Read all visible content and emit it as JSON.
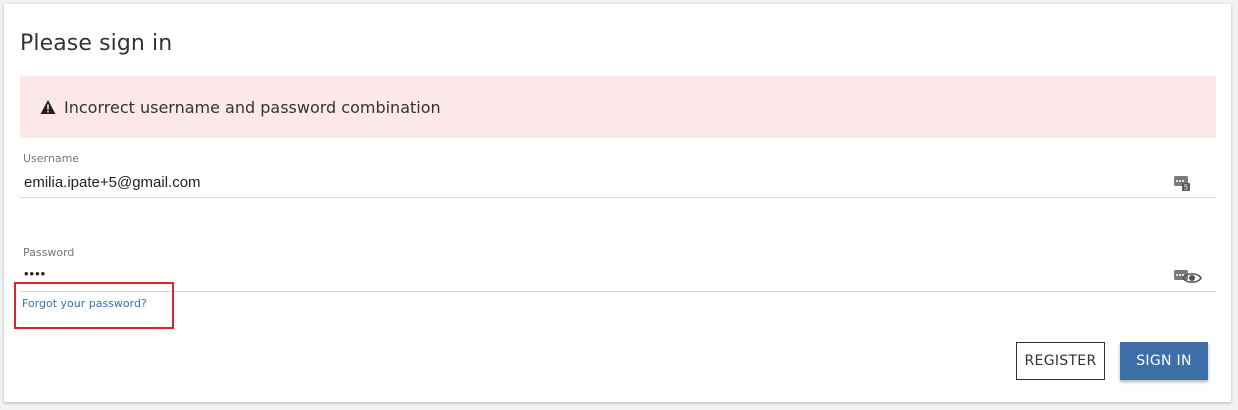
{
  "page_title": "Please sign in",
  "alert": {
    "icon": "warning-icon",
    "message": "Incorrect username and password combination",
    "background": "#fce8e8"
  },
  "username": {
    "label": "Username",
    "value": "emilia.ipate+5@gmail.com",
    "icon": "password-manager-icon"
  },
  "password": {
    "label": "Password",
    "value": "••••",
    "icons": [
      "password-manager-icon",
      "eye-icon"
    ]
  },
  "forgot_password": {
    "text": "Forgot your password?",
    "color": "#3a6fb0",
    "highlight_color": "#d9242c"
  },
  "buttons": {
    "register": "REGISTER",
    "sign_in": "SIGN IN",
    "sign_in_color": "#3d6ea8"
  }
}
